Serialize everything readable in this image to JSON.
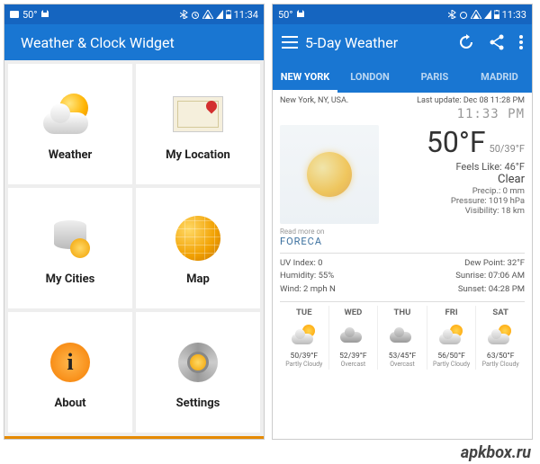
{
  "screen1": {
    "status": {
      "temp": "50°",
      "time": "11:34"
    },
    "title": "Weather & Clock Widget",
    "tiles": [
      {
        "label": "Weather"
      },
      {
        "label": "My Location"
      },
      {
        "label": "My Cities"
      },
      {
        "label": "Map"
      },
      {
        "label": "About"
      },
      {
        "label": "Settings"
      }
    ]
  },
  "screen2": {
    "status": {
      "temp": "50°",
      "time": "11:33"
    },
    "title": "5-Day Weather",
    "tabs": [
      {
        "label": "NEW YORK",
        "active": true
      },
      {
        "label": "LONDON"
      },
      {
        "label": "PARIS"
      },
      {
        "label": "MADRID"
      }
    ],
    "location": "New York, NY, USA.",
    "lastupdate": "Last update: Dec 08  11:28 PM",
    "digitaltime": "11:33 PM",
    "current": {
      "temp": "50°F",
      "hilo": "50/39°F",
      "feels": "Feels Like: 46°F",
      "condition": "Clear",
      "precip": "Precip.: 0 mm",
      "pressure": "Pressure: 1019 hPa",
      "visibility": "Visibility: 18 km"
    },
    "readmore": "Read more on",
    "brand": "FORECA",
    "details": {
      "left": {
        "uv": "UV Index: 0",
        "humidity": "Humidity: 55%",
        "wind": "Wind: 2 mph N"
      },
      "right": {
        "dew": "Dew Point: 32°F",
        "sunrise": "Sunrise: 07:06 AM",
        "sunset": "Sunset: 04:28 PM"
      }
    },
    "forecast": [
      {
        "day": "TUE",
        "icon": "pc",
        "temp": "50/39°F",
        "desc": "Partly Cloudy"
      },
      {
        "day": "WED",
        "icon": "cloudy",
        "temp": "52/39°F",
        "desc": "Overcast"
      },
      {
        "day": "THU",
        "icon": "cloudy",
        "temp": "53/45°F",
        "desc": "Overcast"
      },
      {
        "day": "FRI",
        "icon": "pc",
        "temp": "56/50°F",
        "desc": "Partly Cloudy"
      },
      {
        "day": "SAT",
        "icon": "pc",
        "temp": "63/50°F",
        "desc": "Partly Cloudy"
      }
    ]
  },
  "watermark": "apkbox.ru"
}
